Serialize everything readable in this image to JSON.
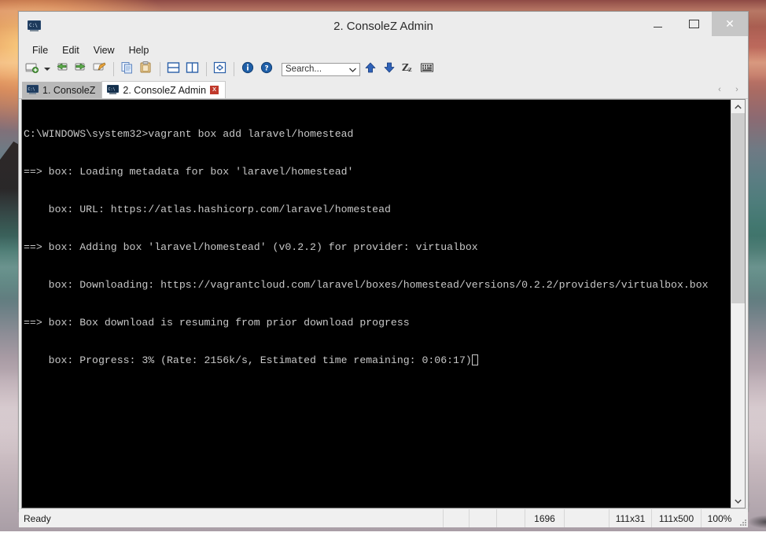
{
  "window": {
    "title": "2. ConsoleZ Admin",
    "icon": "console-app-icon",
    "controls": {
      "minimize": "minimize-button",
      "maximize": "maximize-button",
      "close_glyph": "✕"
    }
  },
  "menubar": {
    "items": [
      {
        "label": "File",
        "name": "menu-file"
      },
      {
        "label": "Edit",
        "name": "menu-edit"
      },
      {
        "label": "View",
        "name": "menu-view"
      },
      {
        "label": "Help",
        "name": "menu-help"
      }
    ]
  },
  "toolbar": {
    "buttons": [
      {
        "name": "new-tab-icon",
        "title": "New Tab"
      },
      {
        "name": "chevron-down-icon",
        "title": "New Tab Dropdown"
      },
      {
        "name": "arrow-left-green-icon",
        "title": "Previous Tab"
      },
      {
        "name": "arrow-right-green-icon",
        "title": "Next Tab"
      },
      {
        "name": "rename-tab-pencil-icon",
        "title": "Rename Tab"
      },
      {
        "name": "copy-icon",
        "title": "Copy"
      },
      {
        "name": "paste-icon",
        "title": "Paste"
      },
      {
        "name": "split-horizontal-icon",
        "title": "Split Horizontally"
      },
      {
        "name": "split-vertical-icon",
        "title": "Split Vertically"
      },
      {
        "name": "fullscreen-icon",
        "title": "Full Screen"
      },
      {
        "name": "info-icon",
        "title": "About"
      },
      {
        "name": "help-icon",
        "title": "Help"
      }
    ],
    "search": {
      "placeholder": "Search...",
      "value": "",
      "name": "search-input"
    },
    "after_search": [
      {
        "name": "arrow-up-blue-icon",
        "title": "Find Previous"
      },
      {
        "name": "arrow-down-blue-icon",
        "title": "Find Next"
      },
      {
        "name": "zoom-text-icon",
        "title": "Zz"
      },
      {
        "name": "keyboard-icon",
        "title": "Keyboard"
      }
    ]
  },
  "tabs": {
    "items": [
      {
        "label": "1. ConsoleZ",
        "active": false,
        "closable": false
      },
      {
        "label": "2. ConsoleZ Admin",
        "active": true,
        "closable": true,
        "close_glyph": "x"
      }
    ],
    "nav": {
      "prev": "‹",
      "next": "›"
    }
  },
  "console": {
    "lines": [
      "C:\\WINDOWS\\system32>vagrant box add laravel/homestead",
      "==> box: Loading metadata for box 'laravel/homestead'",
      "    box: URL: https://atlas.hashicorp.com/laravel/homestead",
      "==> box: Adding box 'laravel/homestead' (v0.2.2) for provider: virtualbox",
      "    box: Downloading: https://vagrantcloud.com/laravel/boxes/homestead/versions/0.2.2/providers/virtualbox.box",
      "==> box: Box download is resuming from prior download progress",
      "    box: Progress: 3% (Rate: 2156k/s, Estimated time remaining: 0:06:17)"
    ],
    "foreground": "#c8c8c8",
    "background": "#000000",
    "scrollbar": {
      "up_glyph": "⌃",
      "down_glyph": "⌄"
    }
  },
  "statusbar": {
    "status": "Ready",
    "cells": [
      {
        "name": "status-cell-empty-1",
        "value": ""
      },
      {
        "name": "status-cell-empty-2",
        "value": ""
      },
      {
        "name": "status-cell-empty-3",
        "value": ""
      },
      {
        "name": "status-cell-lines",
        "value": "1696"
      },
      {
        "name": "status-cell-empty-4",
        "value": ""
      },
      {
        "name": "status-cell-cursor-size",
        "value": "111x31"
      },
      {
        "name": "status-cell-buffer-size",
        "value": "111x500"
      },
      {
        "name": "status-cell-zoom",
        "value": "100%"
      }
    ]
  },
  "colors": {
    "window_chrome": "#ececec",
    "console_bg": "#000000",
    "console_fg": "#c8c8c8",
    "tab_active_bg": "#ffffff",
    "tab_inactive_bg": "#b9b9b9",
    "tab_close_bg": "#c0392b",
    "accent_blue": "#2a5fa8",
    "accent_green": "#4e9a3e"
  }
}
